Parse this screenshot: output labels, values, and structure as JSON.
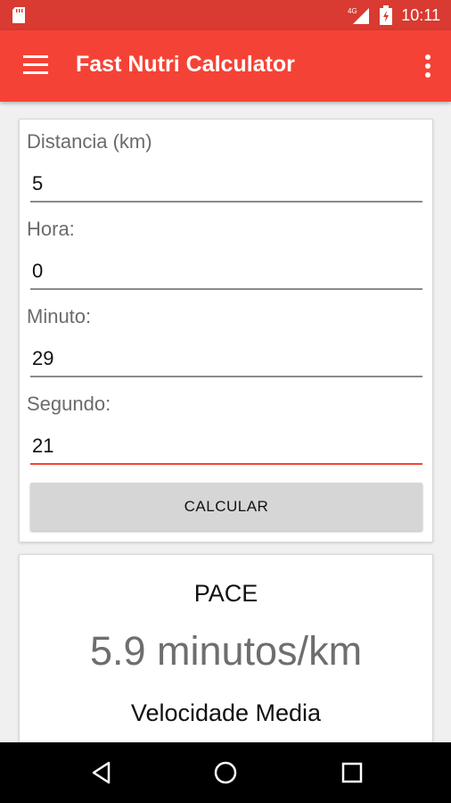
{
  "status_bar": {
    "time": "10:11",
    "network_label": "4G",
    "icons": [
      "sdcard-icon",
      "signal-icon",
      "battery-icon"
    ]
  },
  "app_bar": {
    "title": "Fast Nutri Calculator",
    "menu_icon": "hamburger-menu-icon",
    "overflow_icon": "more-vert-icon",
    "color": "#f44336",
    "status_color": "#d93a31"
  },
  "form": {
    "fields": [
      {
        "label": "Distancia (km)",
        "value": "5"
      },
      {
        "label": "Hora:",
        "value": "0"
      },
      {
        "label": "Minuto:",
        "value": "29"
      },
      {
        "label": "Segundo:",
        "value": "21"
      }
    ],
    "focused_field": 3,
    "button_label": "CALCULAR"
  },
  "result": {
    "pace_title": "PACE",
    "pace_value": "5.9 minutos/km",
    "speed_title": "Velocidade Media"
  },
  "nav_bar": {
    "buttons": [
      "back-icon",
      "home-icon",
      "recents-icon"
    ]
  }
}
